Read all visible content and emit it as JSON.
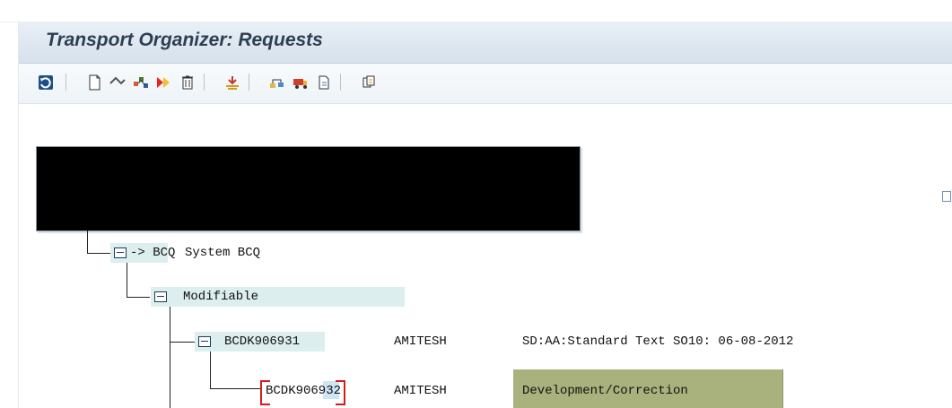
{
  "window": {
    "title": "Transport Organizer: Requests"
  },
  "toolbar": {
    "icons": [
      "refresh-icon",
      "new-document-icon",
      "change-display-icon",
      "object-list-icon",
      "release-icon",
      "delete-icon",
      "import-icon",
      "request-tree-icon",
      "transport-icon",
      "document-icon",
      "copy-icon"
    ]
  },
  "tree": {
    "system_label": "-> BCQ",
    "system_suffix": "System BCQ",
    "status": "Modifiable",
    "requests": [
      {
        "id": "BCDK906931",
        "owner": "AMITESH",
        "description": "SD:AA:Standard Text SO10: 06-08-2012"
      },
      {
        "id": "BCDK906932",
        "owner": "AMITESH",
        "description": "Development/Correction"
      }
    ]
  },
  "colors": {
    "node_highlight": "#dcefee",
    "selected_task": "#a9b27d",
    "selection_bracket": "#d71b1b"
  }
}
